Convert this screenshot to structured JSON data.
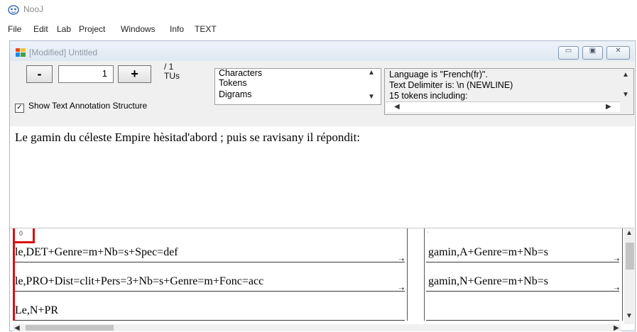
{
  "app": {
    "title": "NooJ"
  },
  "menu": [
    "File",
    "Edit",
    "Lab",
    "Project",
    "Windows",
    "Info",
    "TEXT"
  ],
  "document": {
    "title": "[Modified] Untitled",
    "window_controls": {
      "minimize": "▭",
      "maximize": "▣",
      "close": "✕"
    }
  },
  "toolbar": {
    "minus": "-",
    "plus": "+",
    "page_value": "1",
    "page_total": "/ 1",
    "page_unit": "TUs",
    "show_annotation_label": "Show Text Annotation Structure",
    "show_annotation_checked": true,
    "view_options": [
      "Characters",
      "Tokens",
      "Digrams"
    ],
    "info_lines": [
      "Language is \"French(fr)\".",
      "Text Delimiter is: \\n (NEWLINE)",
      "15 tokens including:"
    ]
  },
  "text": {
    "content": "Le gamin du céleste Empire hèsitad'abord ; puis se ravisany il répondit:"
  },
  "annotations": {
    "column1_index": "0",
    "column1": [
      "le,DET+Genre=m+Nb=s+Spec=def",
      "le,PRO+Dist=clit+Pers=3+Nb=s+Genre=m+Fonc=acc",
      "Le,N+PR"
    ],
    "column2": [
      "gamin,A+Genre=m+Nb=s",
      "gamin,N+Genre=m+Nb=s"
    ]
  },
  "colors": {
    "annotation_marker": "#d81010",
    "window_border": "#a9b8cc"
  }
}
